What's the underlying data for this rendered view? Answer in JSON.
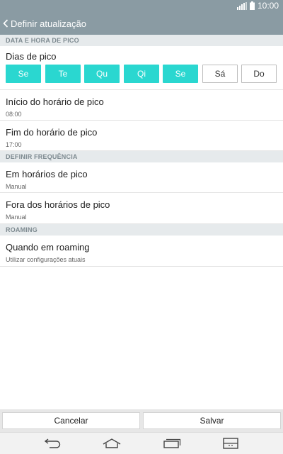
{
  "status_bar": {
    "time": "10:00"
  },
  "header": {
    "title": "Definir atualização"
  },
  "sections": {
    "peak_date_time": "DATA E HORA DE PICO",
    "frequency": "DEFINIR FREQUÊNCIA",
    "roaming": "ROAMING"
  },
  "peak_days": {
    "label": "Dias de pico",
    "days": [
      {
        "label": "Se",
        "selected": true
      },
      {
        "label": "Te",
        "selected": true
      },
      {
        "label": "Qu",
        "selected": true
      },
      {
        "label": "Qi",
        "selected": true
      },
      {
        "label": "Se",
        "selected": true
      },
      {
        "label": "Sá",
        "selected": false
      },
      {
        "label": "Do",
        "selected": false
      }
    ]
  },
  "peak_start": {
    "label": "Início do horário de pico",
    "value": "08:00"
  },
  "peak_end": {
    "label": "Fim do horário de pico",
    "value": "17:00"
  },
  "in_peak": {
    "label": "Em horários de pico",
    "value": "Manual"
  },
  "off_peak": {
    "label": "Fora dos horários de pico",
    "value": "Manual"
  },
  "roaming": {
    "label": "Quando em roaming",
    "value": "Utilizar configurações atuais"
  },
  "actions": {
    "cancel": "Cancelar",
    "save": "Salvar"
  },
  "colors": {
    "header": "#8a9ba3",
    "accent": "#2ad7d0",
    "section_bg": "#e6eaec"
  },
  "icons": {
    "status": [
      "signal-icon",
      "battery-icon"
    ],
    "nav": [
      "back-nav-icon",
      "home-nav-icon",
      "recent-apps-icon",
      "dual-window-icon"
    ]
  }
}
